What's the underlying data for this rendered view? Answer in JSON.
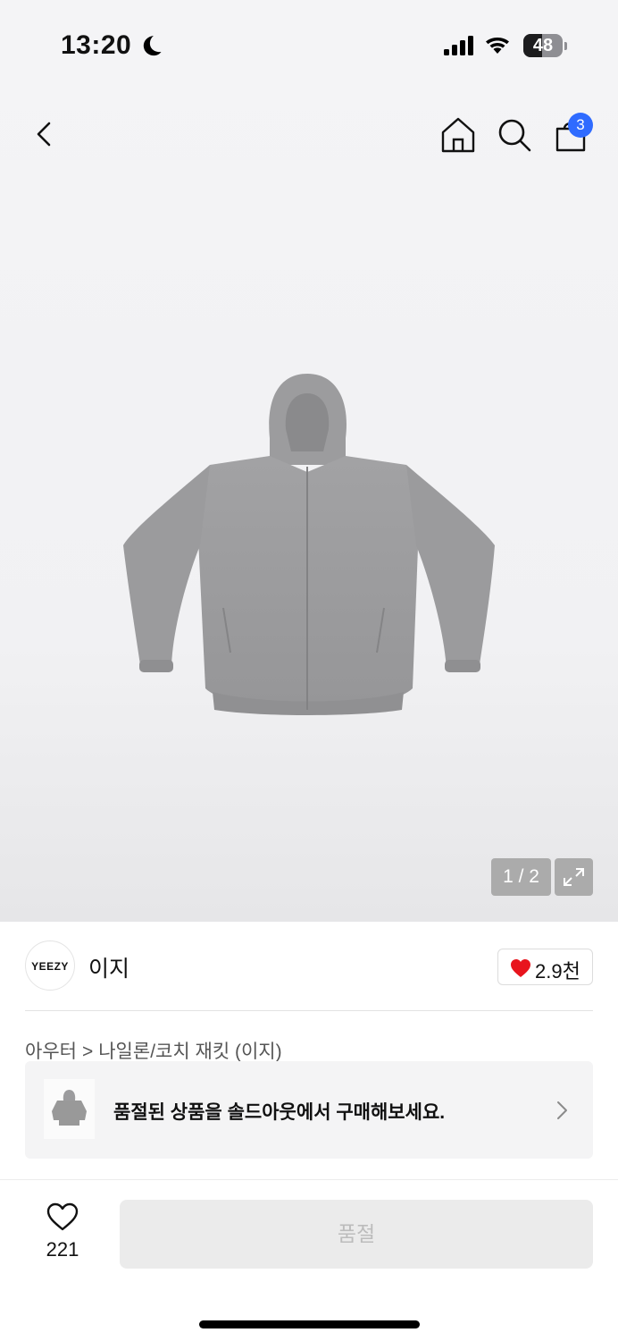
{
  "status_bar": {
    "time": "13:20",
    "battery": "48",
    "battery_level": 0.48
  },
  "nav": {
    "cart_count": "3"
  },
  "gallery": {
    "page_indicator": "1 / 2"
  },
  "brand": {
    "logo_text": "YEEZY",
    "name": "이지",
    "likes": "2.9천",
    "heart_color": "#e8141d"
  },
  "breadcrumb": {
    "category": "아우터",
    "separator": ">",
    "subcategory": "나일론/코치 재킷 (이지)"
  },
  "soldout_banner": {
    "message": "품절된 상품을 솔드아웃에서 구매해보세요."
  },
  "footer": {
    "wish_count": "221",
    "buy_label": "품절"
  },
  "colors": {
    "accent_badge": "#2f6bff",
    "product_gray": "#9b9b9d"
  }
}
